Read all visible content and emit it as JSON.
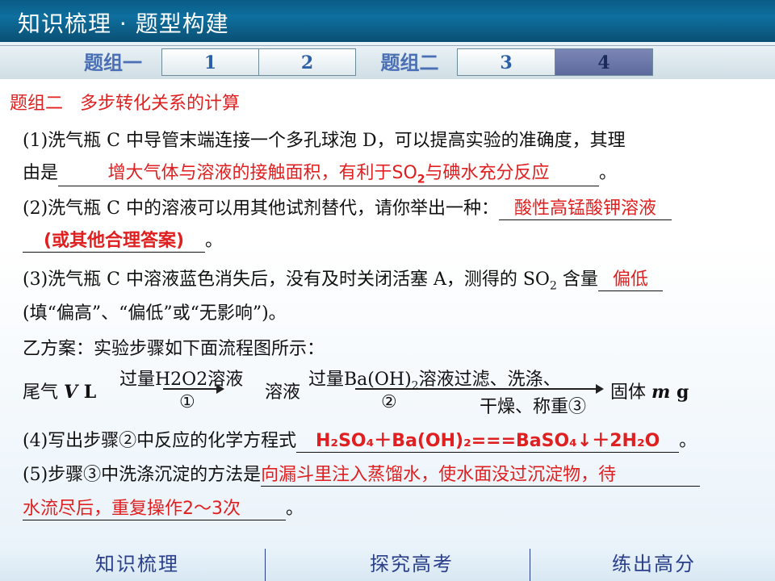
{
  "header": {
    "title": "知识梳理 · 题型构建"
  },
  "tabbar": {
    "group1_label": "题组一",
    "group2_label": "题组二",
    "tabs": [
      "1",
      "2",
      "3",
      "4"
    ],
    "active_tab": "4"
  },
  "content": {
    "heading_prefix": "题组二",
    "heading_title": "多步转化关系的计算",
    "q1_line1": "(1)洗气瓶 C 中导管末端连接一个多孔球泡 D，可以提高实验的准确度，其理",
    "q1_line2_prefix": "由是",
    "q1_answer_a": "增大气体与溶液的接触面积，有利于SO",
    "q1_answer_sub": "2",
    "q1_answer_b": "与碘水充分反应",
    "q1_end": "。",
    "q2_line1": "(2)洗气瓶 C 中的溶液可以用其他试剂替代，请你举出一种：",
    "q2_answer_1": "酸性高锰酸钾溶液",
    "q2_answer_2": "(或其他合理答案)",
    "q2_end": "。",
    "q3_line1_a": "(3)洗气瓶 C 中溶液蓝色消失后，没有及时关闭活塞 A，测得的 SO",
    "q3_line1_sub": "2",
    "q3_line1_b": " 含量",
    "q3_answer": "偏低",
    "q3_line2": "(填“偏高”、“偏低”或“无影响”)。",
    "plan_b": "乙方案：实验步骤如下面流程图所示：",
    "flow": {
      "start_a": "尾气 ",
      "start_var": "V",
      "start_b": " L",
      "step1_top": "过量H2O2溶液",
      "step1_bottom": "①",
      "middle": "溶液",
      "step2_top_a": "过量Ba(OH)",
      "step2_top_sub": "2",
      "step2_top_b": "溶液过滤、洗涤、",
      "step2_bottom_a": "②",
      "step2_bottom_b": "干燥、称重③",
      "end_a": "固体 ",
      "end_var": "m",
      "end_b": " g"
    },
    "q4_prefix": "(4)写出步骤②中反应的化学方程式",
    "q4_answer": "H₂SO₄＋Ba(OH)₂===BaSO₄↓＋2H₂O",
    "q4_end": "。",
    "q5_prefix": "(5)步骤③中洗涤沉淀的方法是",
    "q5_answer_1": "向漏斗里注入蒸馏水，使水面没过沉淀物，待",
    "q5_answer_2": "水流尽后，重复操作2～3次",
    "q5_end": "。"
  },
  "footer": {
    "items": [
      "知识梳理",
      "探究高考",
      "练出高分"
    ]
  }
}
